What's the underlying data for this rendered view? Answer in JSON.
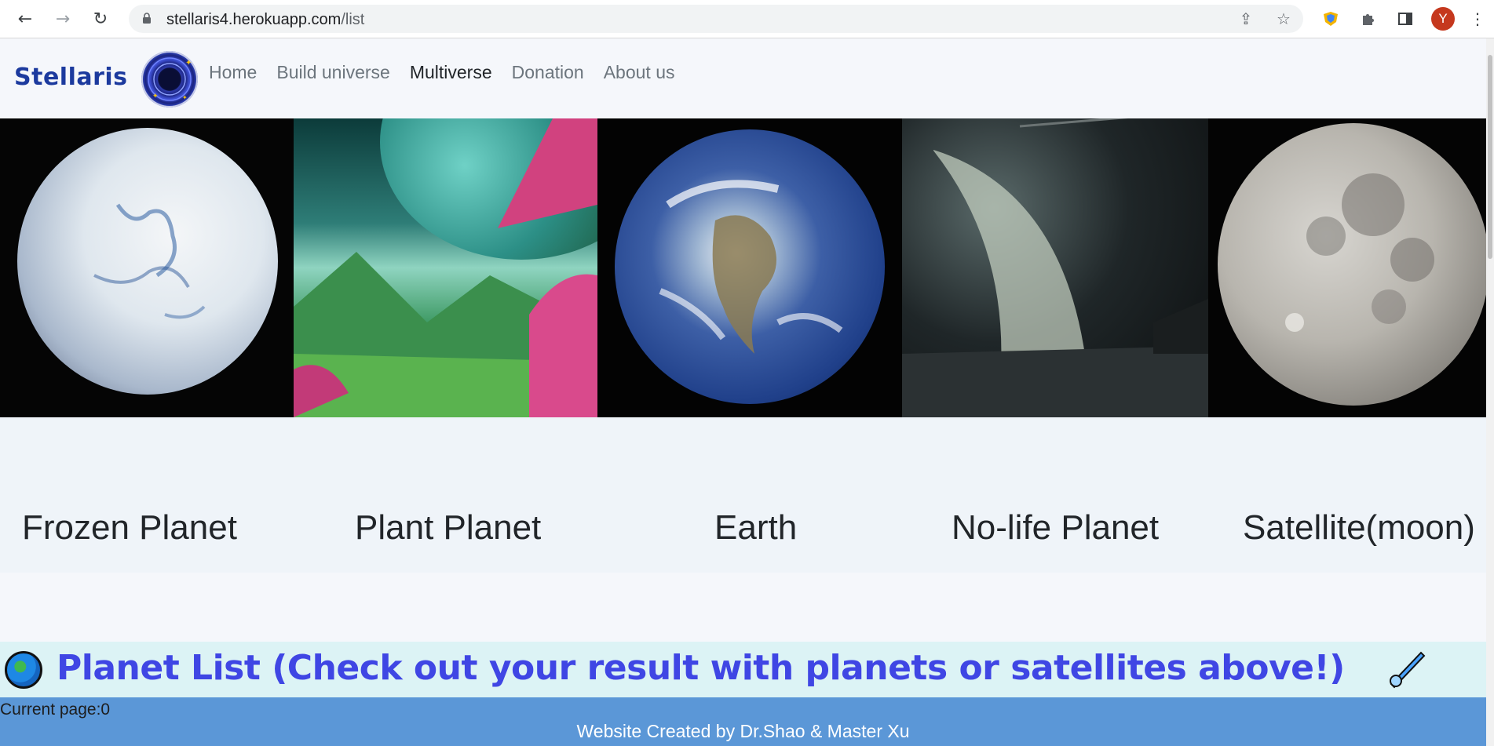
{
  "browser": {
    "url_host": "stellaris4.herokuapp.com",
    "url_path": "/list",
    "avatar_letter": "Y"
  },
  "site": {
    "brand": "Stellaris",
    "nav": [
      {
        "label": "Home",
        "active": false
      },
      {
        "label": "Build universe",
        "active": false
      },
      {
        "label": "Multiverse",
        "active": true
      },
      {
        "label": "Donation",
        "active": false
      },
      {
        "label": "About us",
        "active": false
      }
    ]
  },
  "planets": [
    {
      "name": "Frozen Planet",
      "icon": "frozen-planet-image"
    },
    {
      "name": "Plant Planet",
      "icon": "plant-planet-image"
    },
    {
      "name": "Earth",
      "icon": "earth-image"
    },
    {
      "name": "No-life Planet",
      "icon": "no-life-planet-image"
    },
    {
      "name": "Satellite(moon)",
      "icon": "moon-image"
    }
  ],
  "list_heading": "Planet List (Check out your result with planets or satellites above!)",
  "current_page": "Current page:0",
  "footer": "Website Created by Dr.Shao & Master Xu",
  "colors": {
    "brand": "#1c3a9e",
    "heading": "#3f46e4",
    "banner_bg": "#dcf3f5",
    "footer_bg": "#5b97d7"
  }
}
